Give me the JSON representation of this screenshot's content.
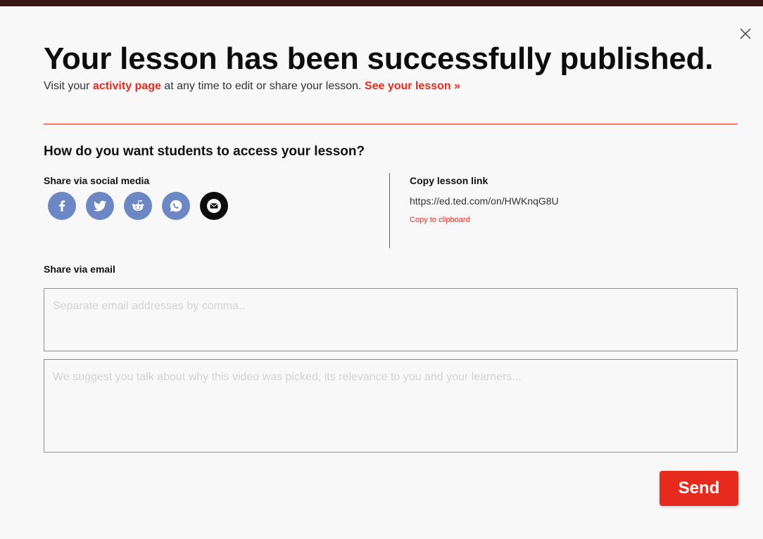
{
  "modal": {
    "title": "Your lesson has been successfully published.",
    "subtitle": {
      "prefix": "Visit your ",
      "activity_link": "activity page",
      "middle": " at any time to edit or share your lesson. ",
      "see_lesson_link": "See your lesson »"
    },
    "question": "How do you want students to access your lesson?"
  },
  "social": {
    "label": "Share via social media",
    "icons": [
      "facebook-icon",
      "twitter-icon",
      "reddit-icon",
      "whatsapp-icon",
      "email-icon"
    ]
  },
  "copy_link": {
    "label": "Copy lesson link",
    "url": "https://ed.ted.com/on/HWKnqG8U",
    "clipboard_label": "Copy to clipboard"
  },
  "email": {
    "label": "Share via email",
    "addresses_placeholder": "Separate email addresses by comma..",
    "message_placeholder": "We suggest you talk about why this video was picked, its relevance to you and your learners..."
  },
  "send_label": "Send",
  "colors": {
    "accent": "#e62b1e",
    "social": "#6d87c4",
    "email_icon_bg": "#0c0c0c"
  }
}
